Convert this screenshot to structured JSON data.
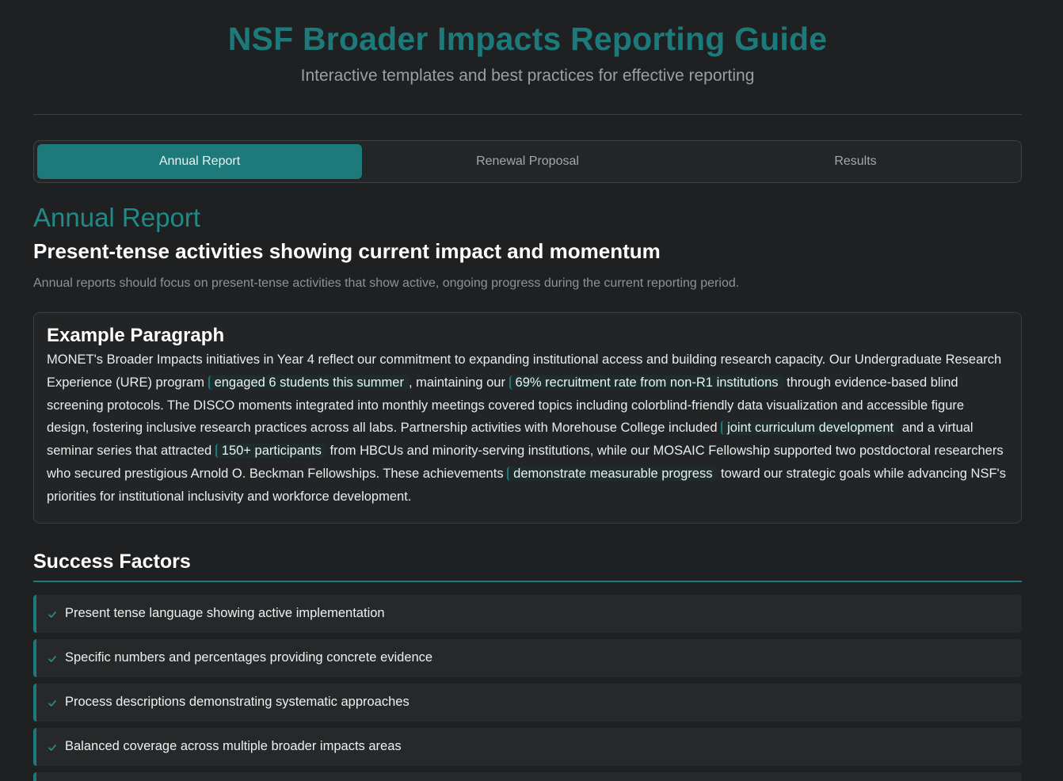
{
  "header": {
    "title": "NSF Broader Impacts Reporting Guide",
    "subtitle": "Interactive templates and best practices for effective reporting"
  },
  "tabs": [
    {
      "label": "Annual Report",
      "active": true
    },
    {
      "label": "Renewal Proposal",
      "active": false
    },
    {
      "label": "Results",
      "active": false
    }
  ],
  "section": {
    "title": "Annual Report",
    "subtitle": "Present-tense activities showing current impact and momentum",
    "description": "Annual reports should focus on present-tense activities that show active, ongoing progress during the current reporting period."
  },
  "example": {
    "title": "Example Paragraph",
    "segments": [
      {
        "text": "MONET's Broader Impacts initiatives in Year 4 reflect our commitment to expanding institutional access and building research capacity. Our Undergraduate Research Experience (URE) program ",
        "highlight": false
      },
      {
        "text": "engaged 6 students this summer",
        "highlight": true
      },
      {
        "text": ", maintaining our ",
        "highlight": false
      },
      {
        "text": "69% recruitment rate from non-R1 institutions",
        "highlight": true
      },
      {
        "text": " through evidence-based blind screening protocols. The DISCO moments integrated into monthly meetings covered topics including colorblind-friendly data visualization and accessible figure design, fostering inclusive research practices across all labs. Partnership activities with Morehouse College included ",
        "highlight": false
      },
      {
        "text": "joint curriculum development",
        "highlight": true
      },
      {
        "text": " and a virtual seminar series that attracted ",
        "highlight": false
      },
      {
        "text": "150+ participants",
        "highlight": true
      },
      {
        "text": " from HBCUs and minority-serving institutions, while our MOSAIC Fellowship supported two postdoctoral researchers who secured prestigious Arnold O. Beckman Fellowships. These achievements ",
        "highlight": false
      },
      {
        "text": "demonstrate measurable progress",
        "highlight": true
      },
      {
        "text": " toward our strategic goals while advancing NSF's priorities for institutional inclusivity and workforce development.",
        "highlight": false
      }
    ]
  },
  "success_factors": {
    "title": "Success Factors",
    "items": [
      "Present tense language showing active implementation",
      "Specific numbers and percentages providing concrete evidence",
      "Process descriptions demonstrating systematic approaches",
      "Balanced coverage across multiple broader impacts areas",
      ""
    ]
  },
  "colors": {
    "accent": "#1e7a7a",
    "background": "#1e2021"
  },
  "icons": {
    "check": "check-icon"
  }
}
